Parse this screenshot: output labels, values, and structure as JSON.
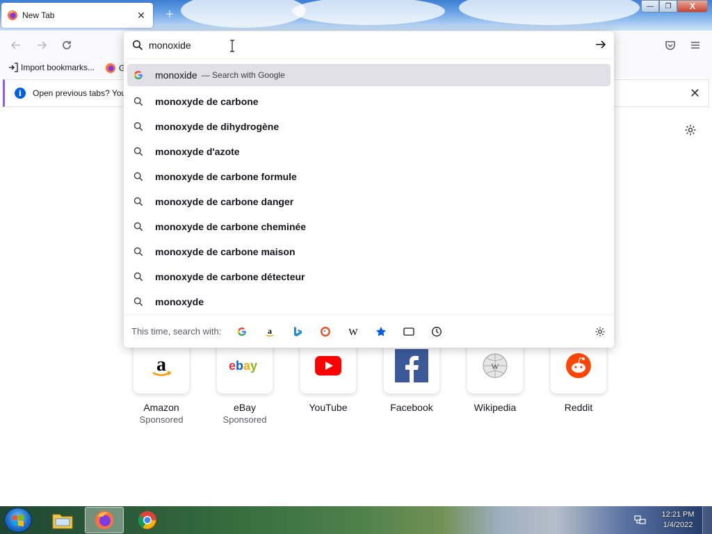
{
  "tab": {
    "title": "New Tab",
    "close_glyph": "✕"
  },
  "window": {
    "new_tab_glyph": "+",
    "min_glyph": "—",
    "restore_glyph": "❐",
    "close_glyph": "X"
  },
  "bookmarks": {
    "import_label": "Import bookmarks...",
    "partial_label": "G"
  },
  "notice": {
    "text": "Open previous tabs? You",
    "close_glyph": "✕",
    "info_glyph": "i"
  },
  "urlbar": {
    "value": "monoxide",
    "heuristic": {
      "text": "monoxide",
      "action": "— Search with Google"
    },
    "suggestions": [
      "monoxyde de carbone",
      "monoxyde de dihydrogène",
      "monoxyde d'azote",
      "monoxyde de carbone formule",
      "monoxyde de carbone danger",
      "monoxyde de carbone cheminée",
      "monoxyde de carbone maison",
      "monoxyde de carbone détecteur",
      "monoxyde"
    ],
    "oneoff_label": "This time, search with:",
    "oneoff_engines": [
      "google-icon",
      "amazon-icon",
      "bing-icon",
      "duckduckgo-icon",
      "wikipedia-icon",
      "bookmarks-icon",
      "tabs-icon",
      "history-icon"
    ]
  },
  "shortcuts": [
    {
      "label": "Amazon",
      "sponsored": "Sponsored"
    },
    {
      "label": "eBay",
      "sponsored": "Sponsored"
    },
    {
      "label": "YouTube",
      "sponsored": ""
    },
    {
      "label": "Facebook",
      "sponsored": ""
    },
    {
      "label": "Wikipedia",
      "sponsored": ""
    },
    {
      "label": "Reddit",
      "sponsored": ""
    }
  ],
  "taskbar": {
    "time": "12:21 PM",
    "date": "1/4/2022"
  },
  "colors": {
    "accent": "#0060df",
    "notice_border": "#9059ff",
    "selected_row": "#e0e0e6"
  }
}
